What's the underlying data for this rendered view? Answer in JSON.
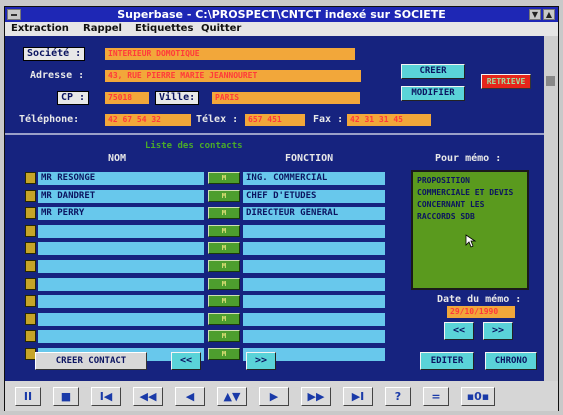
{
  "window": {
    "title": "Superbase - C:\\PROSPECT\\CNTCT indexé sur SOCIETE"
  },
  "menu": [
    "Extraction",
    "Rappel",
    "Etiquettes",
    "Quitter"
  ],
  "form": {
    "societe_label": "Société :",
    "societe_value": "INTERIEUR DOMOTIQUE",
    "adresse_label": "Adresse :",
    "adresse_value": "43, RUE PIERRE MARIE JEANNOURET",
    "cp_label": "CP :",
    "cp_value": "75018",
    "ville_label": "Ville:",
    "ville_value": "PARIS",
    "telephone_label": "Téléphone:",
    "telephone_value": "42 67 54 32",
    "telex_label": "Télex :",
    "telex_value": "657 451",
    "fax_label": "Fax :",
    "fax_value": "42 31 31 45"
  },
  "buttons": {
    "creer": "CREER",
    "modifier": "MODIFIER",
    "retrieve": "RETRIEVE",
    "creer_contact": "CREER CONTACT",
    "prev": "<<",
    "next": ">>",
    "editer": "EDITER",
    "chrono": "CHRONO"
  },
  "contacts": {
    "list_title": "Liste des contacts",
    "nom_header": "NOM",
    "fonction_header": "FONCTION",
    "mark": "M",
    "rows": [
      {
        "nom": "MR RESONGE",
        "fonction": "ING. COMMERCIAL"
      },
      {
        "nom": "MR DANDRET",
        "fonction": "CHEF D'ETUDES"
      },
      {
        "nom": "MR PERRY",
        "fonction": "DIRECTEUR GENERAL"
      },
      {
        "nom": "",
        "fonction": ""
      },
      {
        "nom": "",
        "fonction": ""
      },
      {
        "nom": "",
        "fonction": ""
      },
      {
        "nom": "",
        "fonction": ""
      },
      {
        "nom": "",
        "fonction": ""
      },
      {
        "nom": "",
        "fonction": ""
      },
      {
        "nom": "",
        "fonction": ""
      },
      {
        "nom": "",
        "fonction": ""
      }
    ]
  },
  "memo": {
    "label": "Pour mémo :",
    "text": "PROPOSITION COMMERCIALE ET DEVIS CONCERNANT LES RACCORDS SDB",
    "date_label": "Date du mémo :",
    "date_value": "29/10/1990"
  },
  "toolbar": [
    "II",
    "■",
    "I◀",
    "◀◀",
    "◀",
    "▲▼",
    "▶",
    "▶▶",
    "▶I",
    "?",
    "=",
    "▪0▪"
  ],
  "colors": {
    "titlebar": "#1e27b5",
    "background": "#16237f",
    "field": "#f2a73a",
    "field_text": "#ff3a3a",
    "cyan": "#5ad3d8",
    "memo": "#5a9a1e"
  }
}
